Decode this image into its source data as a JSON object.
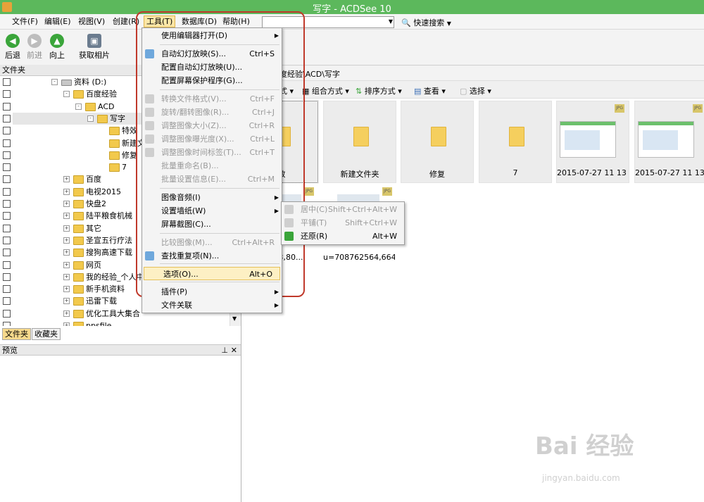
{
  "window": {
    "title": "写字 - ACDSee 10"
  },
  "menubar": {
    "file": "文件(F)",
    "edit": "编辑(E)",
    "view": "视图(V)",
    "create": "创建(R)",
    "tools": "工具(T)",
    "database": "数据库(D)",
    "help": "帮助(H)",
    "quick_search": "快速搜索"
  },
  "toolbar": {
    "back": "后退",
    "forward": "前进",
    "up": "向上",
    "acquire": "获取相片"
  },
  "left": {
    "folder_header": "文件夹",
    "tree": [
      {
        "label": "资料 (D:)",
        "level": 0,
        "expander": "-",
        "drive": true
      },
      {
        "label": "百度经验",
        "level": 1,
        "expander": "-"
      },
      {
        "label": "ACD",
        "level": 2,
        "expander": "-"
      },
      {
        "label": "写字",
        "level": 3,
        "expander": "-",
        "selected": true
      },
      {
        "label": "特效",
        "level": 4,
        "expander": ""
      },
      {
        "label": "新建文件夹",
        "level": 4,
        "expander": ""
      },
      {
        "label": "修复",
        "level": 4,
        "expander": ""
      },
      {
        "label": "7",
        "level": 4,
        "expander": ""
      },
      {
        "label": "百度",
        "level": 1,
        "expander": "+"
      },
      {
        "label": "电视2015",
        "level": 1,
        "expander": "+"
      },
      {
        "label": "快盘2",
        "level": 1,
        "expander": "+"
      },
      {
        "label": "陆平粮食机械",
        "level": 1,
        "expander": "+"
      },
      {
        "label": "其它",
        "level": 1,
        "expander": "+"
      },
      {
        "label": "圣宣五行疗法",
        "level": 1,
        "expander": "+"
      },
      {
        "label": "搜狗高速下载",
        "level": 1,
        "expander": "+"
      },
      {
        "label": "网页",
        "level": 1,
        "expander": "+"
      },
      {
        "label": "我的经验_个人中心_百",
        "level": 1,
        "expander": "+"
      },
      {
        "label": "新手机资料",
        "level": 1,
        "expander": "+"
      },
      {
        "label": "迅雷下载",
        "level": 1,
        "expander": "+"
      },
      {
        "label": "优化工具大集合",
        "level": 1,
        "expander": "+"
      },
      {
        "label": "ppsfile",
        "level": 1,
        "expander": "+"
      }
    ],
    "tab_folders": "文件夹",
    "tab_favorites": "收藏夹",
    "preview_header": "预览"
  },
  "right": {
    "path": "度经验\\ACD\\写字",
    "filter": {
      "mode": "式",
      "group": "组合方式",
      "sort": "排序方式",
      "view": "查看",
      "select": "选择"
    },
    "thumbs_row1": [
      {
        "caption": "效",
        "kind": "folder"
      },
      {
        "caption": "新建文件夹",
        "kind": "folder"
      },
      {
        "caption": "修复",
        "kind": "folder"
      },
      {
        "caption": "7",
        "kind": "folder"
      },
      {
        "caption": "2015-07-27 11 13 ...",
        "kind": "image"
      },
      {
        "caption": "2015-07-27 11 13 ...",
        "kind": "image"
      }
    ],
    "thumbs_row2": [
      {
        "caption": "28483,80..."
      },
      {
        "caption": "u=708762564,664..."
      }
    ]
  },
  "tools_menu": {
    "items": [
      {
        "label": "使用编辑器打开(D)",
        "shortcut": "",
        "submenu": true,
        "disabled": false,
        "icon": ""
      },
      {
        "label": "自动幻灯放映(S)...",
        "shortcut": "Ctrl+S",
        "submenu": false,
        "disabled": false,
        "icon": "slideshow-icon"
      },
      {
        "label": "配置自动幻灯放映(U)...",
        "shortcut": "",
        "submenu": false,
        "disabled": false,
        "icon": ""
      },
      {
        "label": "配置屏幕保护程序(G)...",
        "shortcut": "",
        "submenu": false,
        "disabled": false,
        "icon": ""
      },
      {
        "label": "转换文件格式(V)...",
        "shortcut": "Ctrl+F",
        "submenu": false,
        "disabled": true,
        "icon": "convert-icon"
      },
      {
        "label": "旋转/翻转图像(R)...",
        "shortcut": "Ctrl+J",
        "submenu": false,
        "disabled": true,
        "icon": "rotate-icon"
      },
      {
        "label": "调整图像大小(Z)...",
        "shortcut": "Ctrl+R",
        "submenu": false,
        "disabled": true,
        "icon": "resize-icon"
      },
      {
        "label": "调整图像曝光度(X)...",
        "shortcut": "Ctrl+L",
        "submenu": false,
        "disabled": true,
        "icon": "exposure-icon"
      },
      {
        "label": "调整图像时间标签(T)...",
        "shortcut": "Ctrl+T",
        "submenu": false,
        "disabled": true,
        "icon": "clock-icon"
      },
      {
        "label": "批量重命名(B)...",
        "shortcut": "",
        "submenu": false,
        "disabled": true,
        "icon": ""
      },
      {
        "label": "批量设置信息(E)...",
        "shortcut": "Ctrl+M",
        "submenu": false,
        "disabled": true,
        "icon": ""
      },
      {
        "label": "图像音频(I)",
        "shortcut": "",
        "submenu": true,
        "disabled": false,
        "icon": ""
      },
      {
        "label": "设置墙纸(W)",
        "shortcut": "",
        "submenu": true,
        "disabled": false,
        "icon": ""
      },
      {
        "label": "屏幕截图(C)...",
        "shortcut": "",
        "submenu": false,
        "disabled": false,
        "icon": ""
      },
      {
        "label": "比较图像(M)...",
        "shortcut": "Ctrl+Alt+R",
        "submenu": false,
        "disabled": true,
        "icon": ""
      },
      {
        "label": "查找重复项(N)...",
        "shortcut": "",
        "submenu": false,
        "disabled": false,
        "icon": "duplicate-icon"
      },
      {
        "label": "选项(O)...",
        "shortcut": "Alt+O",
        "submenu": false,
        "disabled": false,
        "icon": ""
      },
      {
        "label": "插件(P)",
        "shortcut": "",
        "submenu": true,
        "disabled": false,
        "icon": ""
      },
      {
        "label": "文件关联",
        "shortcut": "",
        "submenu": true,
        "disabled": false,
        "icon": ""
      }
    ]
  },
  "wallpaper_menu": {
    "items": [
      {
        "label": "居中(C)",
        "shortcut": "Shift+Ctrl+Alt+W",
        "disabled": true
      },
      {
        "label": "平铺(T)",
        "shortcut": "Shift+Ctrl+W",
        "disabled": true
      },
      {
        "label": "还原(R)",
        "shortcut": "Alt+W",
        "disabled": false
      }
    ]
  },
  "watermark": {
    "brand": "Bai 经验",
    "url": "jingyan.baidu.com"
  },
  "colors": {
    "title_bar": "#5cb85c",
    "highlight": "#fdf0c4",
    "annotation": "#c0392b"
  }
}
